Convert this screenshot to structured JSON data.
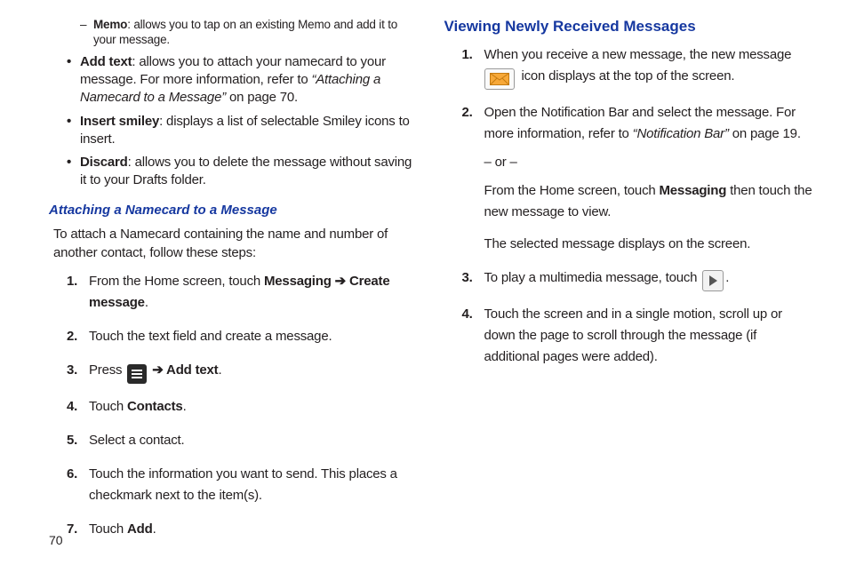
{
  "left": {
    "memo_item": {
      "label": "Memo",
      "text": ": allows you to tap on an existing Memo and add it to your message."
    },
    "addtext_item": {
      "label": "Add text",
      "text_a": ": allows you to attach your namecard to your message. For more information, refer to ",
      "ref": "“Attaching a Namecard to a Message” ",
      "text_b": " on page 70."
    },
    "smiley_item": {
      "label": "Insert smiley",
      "text": ": displays a list of selectable Smiley icons to insert."
    },
    "discard_item": {
      "label": "Discard",
      "text": ": allows you to delete the message without saving it to your Drafts folder."
    },
    "h3": "Attaching a Namecard to a Message",
    "intro": "To attach a Namecard containing the name and number of another contact, follow these steps:",
    "steps": {
      "s1_a": "From the Home screen, touch ",
      "s1_b": "Messaging ➔ Create message",
      "s1_c": ".",
      "s2": "Touch the text field and create a message.",
      "s3_a": "Press ",
      "s3_b": " ➔ Add text",
      "s3_c": ".",
      "s4_a": "Touch ",
      "s4_b": "Contacts",
      "s4_c": ".",
      "s5": "Select a contact.",
      "s6": "Touch the information you want to send. This places a checkmark next to the item(s).",
      "s7_a": "Touch ",
      "s7_b": "Add",
      "s7_c": "."
    }
  },
  "right": {
    "h2": "Viewing Newly Received Messages",
    "s1_a": "When you receive a new message, the new message ",
    "s1_b": " icon displays at the top of the screen.",
    "s2_a": "Open the Notification Bar and select the message. For more information, refer to ",
    "s2_ref": "“Notification Bar” ",
    "s2_b": " on page 19.",
    "s2_or": "– or –",
    "s2_c_a": "From the Home screen, touch ",
    "s2_c_b": "Messaging",
    "s2_c_c": "  then touch the new message to view.",
    "s2_d": "The selected message displays on the screen.",
    "s3_a": "To play a multimedia message, touch ",
    "s3_b": ".",
    "s4": "Touch the screen and in a single motion, scroll up or down the page to scroll through the message (if additional pages were added)."
  },
  "page_number": "70"
}
